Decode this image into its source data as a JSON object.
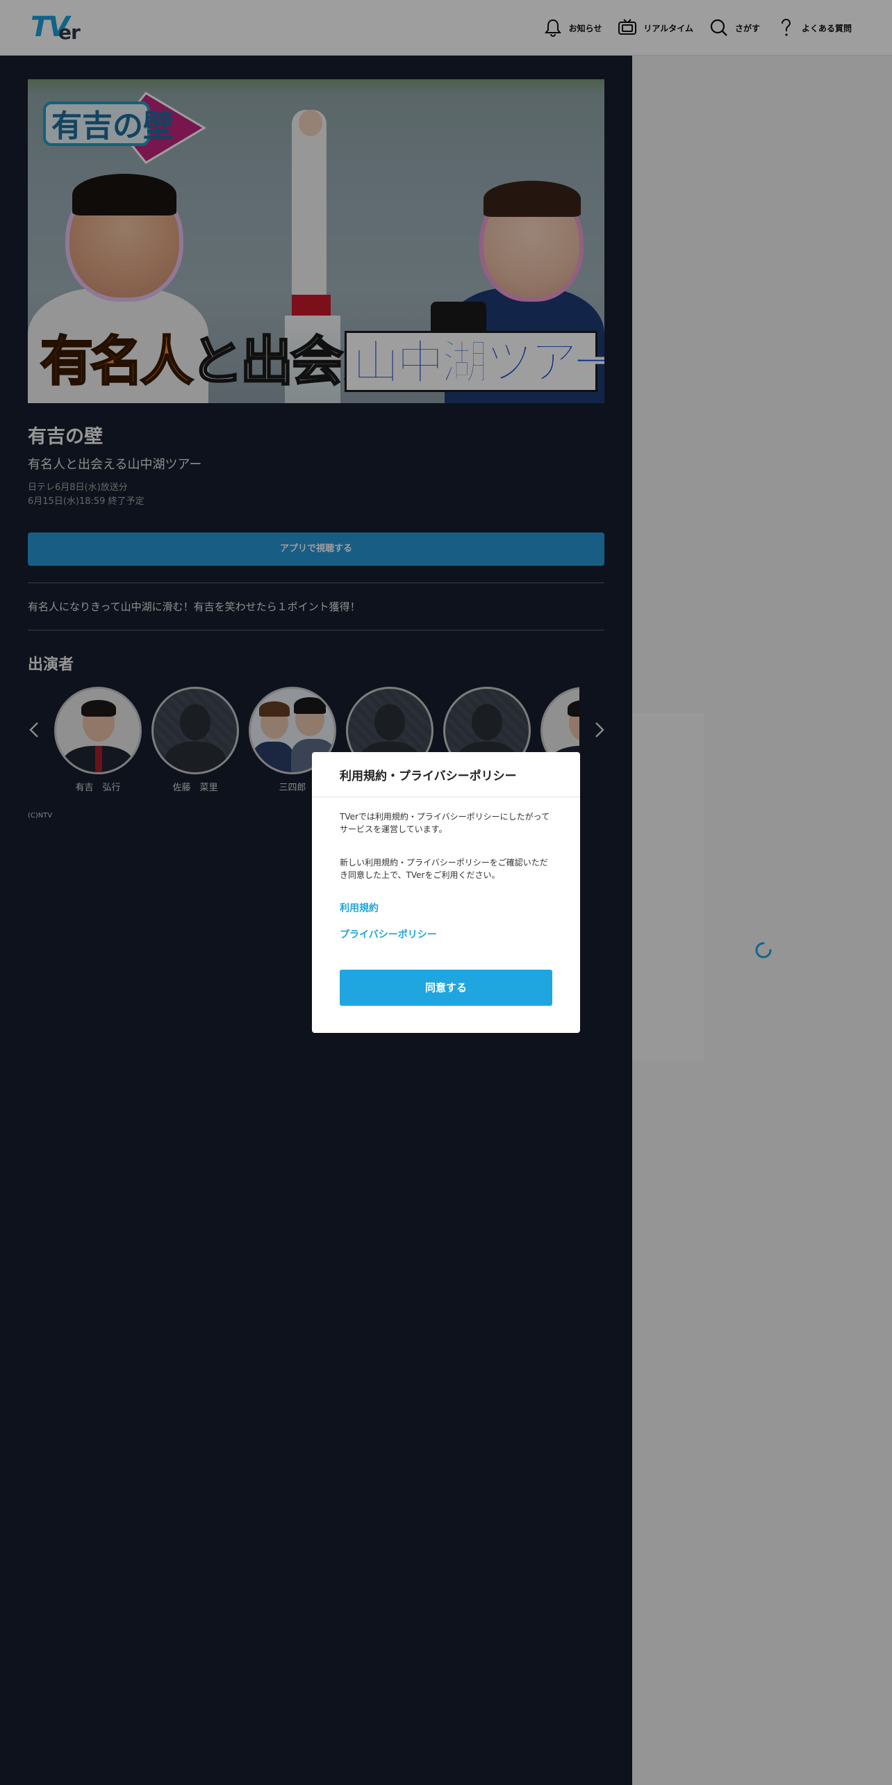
{
  "header": {
    "logo_text_tv": "TV",
    "logo_text_er": "er",
    "nav": [
      {
        "label": "お知らせ",
        "icon": "bell-icon"
      },
      {
        "label": "リアルタイム",
        "icon": "tv-icon"
      },
      {
        "label": "さがす",
        "icon": "search-icon"
      },
      {
        "label": "よくある質問",
        "icon": "question-icon"
      }
    ]
  },
  "episode": {
    "thumbnail": {
      "logo_text": "有吉の壁",
      "caption_left_orange": "有名人",
      "caption_left_white": "と出会える",
      "caption_right": "山中湖ツアー"
    },
    "show_title": "有吉の壁",
    "episode_title": "有名人と出会える山中湖ツアー",
    "broadcast": "日テレ6月8日(水)放送分",
    "expire": "6月15日(水)18:59 終了予定",
    "app_button_label": "アプリで視聴する",
    "description": "有名人になりきって山中湖に滑む！有吉を笑わせたら１ポイント獲得！"
  },
  "cast": {
    "heading": "出演者",
    "members": [
      {
        "name": "有吉　弘行"
      },
      {
        "name": "佐藤　菜里"
      },
      {
        "name": "三四郎"
      }
    ],
    "copyright": "(C)NTV"
  },
  "modal": {
    "title": "利用規約・プライバシーポリシー",
    "paragraph1": "TVerでは利用規約・プライバシーポリシーにしたがってサービスを運営しています。",
    "paragraph2": "新しい利用規約・プライバシーポリシーをご確認いただき同意した上で、TVerをご利用ください。",
    "link_terms": "利用規約",
    "link_privacy": "プライバシーポリシー",
    "agree_label": "同意する"
  },
  "colors": {
    "accent": "#1fa6e0",
    "dark_bg": "#161d2e"
  }
}
